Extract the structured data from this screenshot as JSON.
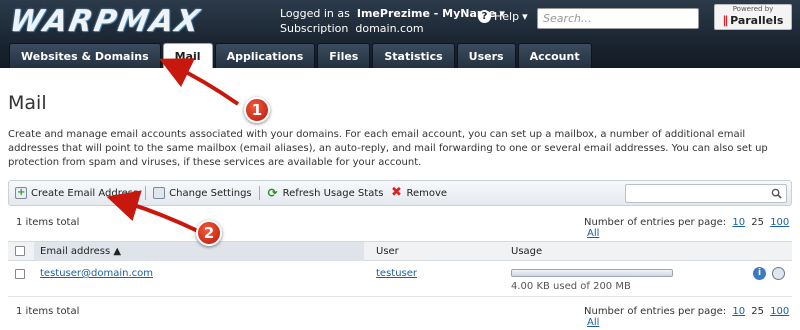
{
  "header": {
    "logo": "WARPMAX",
    "login_prefix": "Logged in as",
    "user_name": "ImePrezime - MyName",
    "subscription_label": "Subscription",
    "subscription_value": "domain.com",
    "help_label": "Help",
    "search_placeholder": "Search...",
    "parallels_top": "Powered by",
    "parallels_name": "Parallels"
  },
  "tabs": [
    {
      "label": "Websites & Domains"
    },
    {
      "label": "Mail"
    },
    {
      "label": "Applications"
    },
    {
      "label": "Files"
    },
    {
      "label": "Statistics"
    },
    {
      "label": "Users"
    },
    {
      "label": "Account"
    }
  ],
  "page": {
    "title": "Mail",
    "description": "Create and manage email accounts associated with your domains. For each email account, you can set up a mailbox, a number of additional email addresses that will point to the same mailbox (email aliases), an auto-reply, and mail forwarding to one or several email addresses. You can also set up protection from spam and viruses, if these services are available for your account."
  },
  "toolbar": {
    "create": "Create Email Address",
    "change": "Change Settings",
    "refresh": "Refresh Usage Stats",
    "remove": "Remove"
  },
  "list": {
    "total": "1 items total",
    "per_page_label": "Number of entries per page:",
    "per_page_options": [
      "10",
      "25",
      "100",
      "All"
    ],
    "columns": {
      "email": "Email address ▲",
      "user": "User",
      "usage": "Usage"
    },
    "rows": [
      {
        "email": "testuser@domain.com",
        "user": "testuser",
        "usage": "4.00 KB used of 200 MB",
        "usage_fraction": 0.0
      }
    ]
  },
  "annotations": [
    "1",
    "2"
  ],
  "colors": {
    "accent_red": "#c8170c",
    "link": "#1a5fa8",
    "header_dark": "#1b2632"
  }
}
